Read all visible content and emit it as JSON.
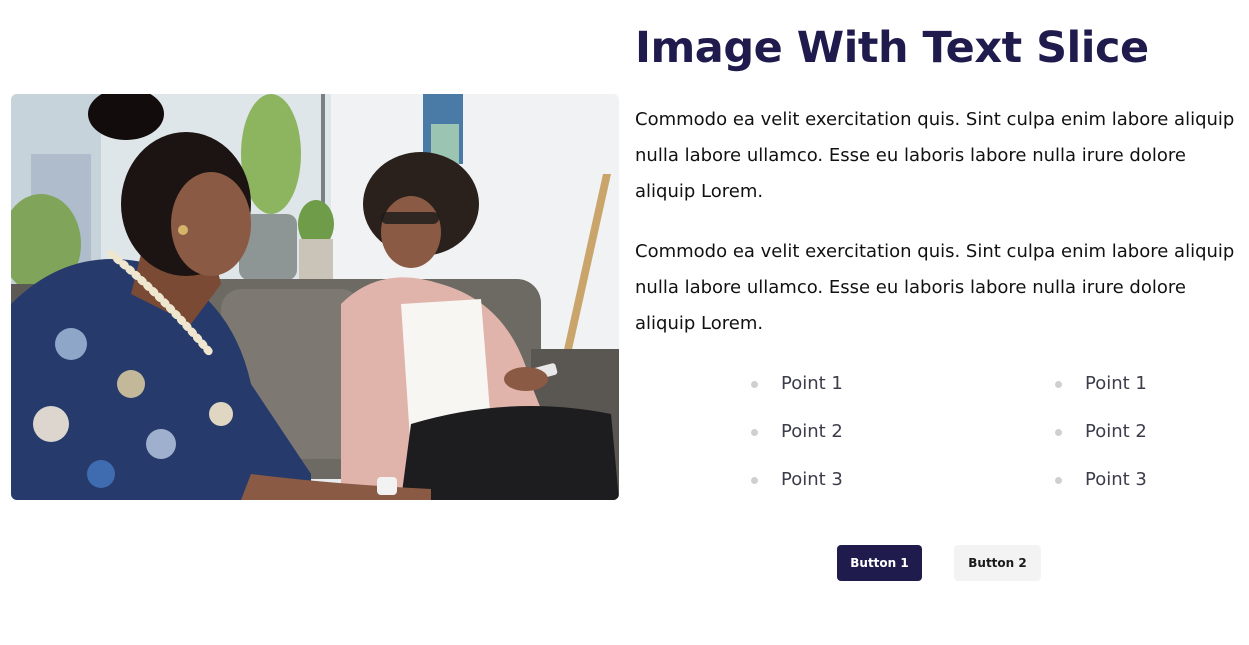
{
  "slice": {
    "title": "Image With Text Slice",
    "paragraphs": [
      "Commodo ea velit exercitation quis. Sint culpa enim labore aliquip nulla labore ullamco. Esse eu laboris labore nulla irure dolore aliquip Lorem.",
      "Commodo ea velit exercitation quis. Sint culpa enim labore aliquip nulla labore ullamco. Esse eu laboris labore nulla irure dolore aliquip Lorem."
    ],
    "points_left": [
      "Point 1",
      "Point 2",
      "Point 3"
    ],
    "points_right": [
      "Point 1",
      "Point 2",
      "Point 3"
    ],
    "buttons": {
      "primary_label": "Button 1",
      "secondary_label": "Button 2"
    }
  },
  "colors": {
    "primary": "#1f1b4d",
    "secondary_button_bg": "#f3f3f4",
    "bullet": "#cfcfd4"
  }
}
